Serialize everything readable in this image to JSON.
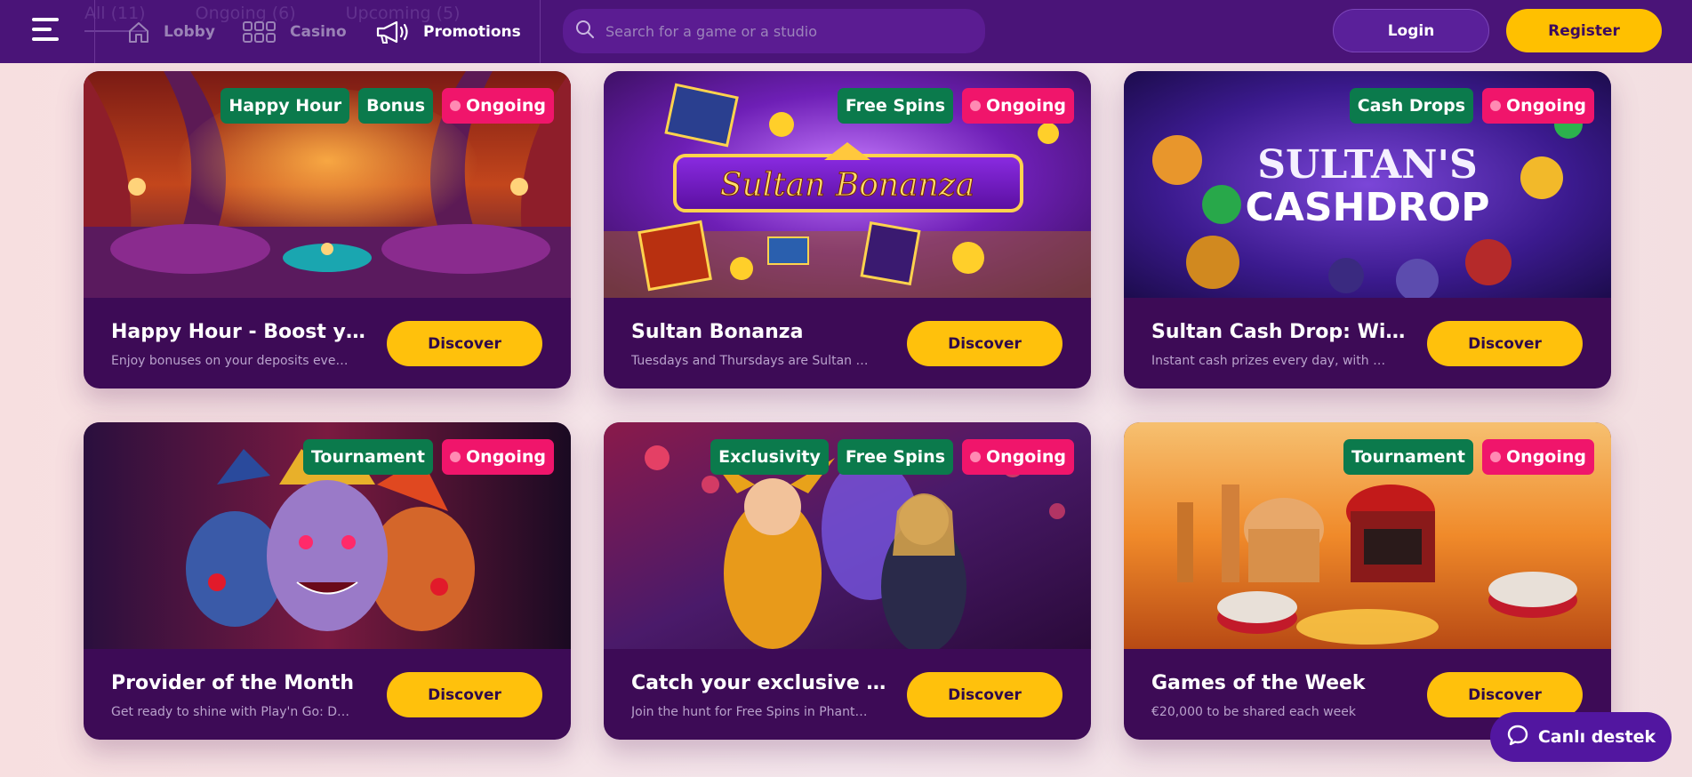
{
  "header": {
    "background_tabs": [
      "All (11)",
      "Ongoing (6)",
      "Upcoming (5)"
    ],
    "nav": [
      {
        "label": "Lobby",
        "icon": "home-icon"
      },
      {
        "label": "Casino",
        "icon": "grid-icon"
      },
      {
        "label": "Promotions",
        "icon": "megaphone-icon",
        "active": true
      }
    ],
    "search_placeholder": "Search for a game or a studio",
    "login_label": "Login",
    "register_label": "Register"
  },
  "cards": [
    {
      "title": "Happy Hour - Boost your deposits",
      "description": "Enjoy bonuses on your deposits every day",
      "tags": [
        {
          "text": "Happy Hour",
          "style": "green"
        },
        {
          "text": "Bonus",
          "style": "green"
        },
        {
          "text": "Ongoing",
          "style": "pink"
        }
      ],
      "button": "Discover"
    },
    {
      "title": "Sultan Bonanza",
      "description": "Tuesdays and Thursdays are Sultan Bonanza days",
      "image_text": "Sultan Bonanza",
      "tags": [
        {
          "text": "Free Spins",
          "style": "green"
        },
        {
          "text": "Ongoing",
          "style": "pink"
        }
      ],
      "button": "Discover"
    },
    {
      "title": "Sultan Cash Drop: Win your share",
      "description": "Instant cash prizes every day, with no conditions",
      "image_text_1": "SULTAN'S",
      "image_text_2": "CASHDROP",
      "tags": [
        {
          "text": "Cash Drops",
          "style": "green"
        },
        {
          "text": "Ongoing",
          "style": "pink"
        }
      ],
      "button": "Discover"
    },
    {
      "title": "Provider of the Month",
      "description": "Get ready to shine with Play'n Go: Dominate",
      "tags": [
        {
          "text": "Tournament",
          "style": "green"
        },
        {
          "text": "Ongoing",
          "style": "pink"
        }
      ],
      "button": "Discover"
    },
    {
      "title": "Catch your exclusive Free Spins",
      "description": "Join the hunt for Free Spins in Phantom Thief",
      "tags": [
        {
          "text": "Exclusivity",
          "style": "green"
        },
        {
          "text": "Free Spins",
          "style": "green"
        },
        {
          "text": "Ongoing",
          "style": "pink"
        }
      ],
      "button": "Discover"
    },
    {
      "title": "Games of the Week",
      "description": "€20,000 to be shared each week",
      "tags": [
        {
          "text": "Tournament",
          "style": "green"
        },
        {
          "text": "Ongoing",
          "style": "pink"
        }
      ],
      "button": "Discover"
    }
  ],
  "support": {
    "label": "Canlı destek",
    "icon": "chat-bubble-icon"
  },
  "colors": {
    "nav_bg": "#4a1478",
    "card_body": "#3d0b56",
    "accent_yellow": "#ffc10c",
    "tag_green": "#0b7a4c",
    "tag_pink": "#f0156b"
  }
}
